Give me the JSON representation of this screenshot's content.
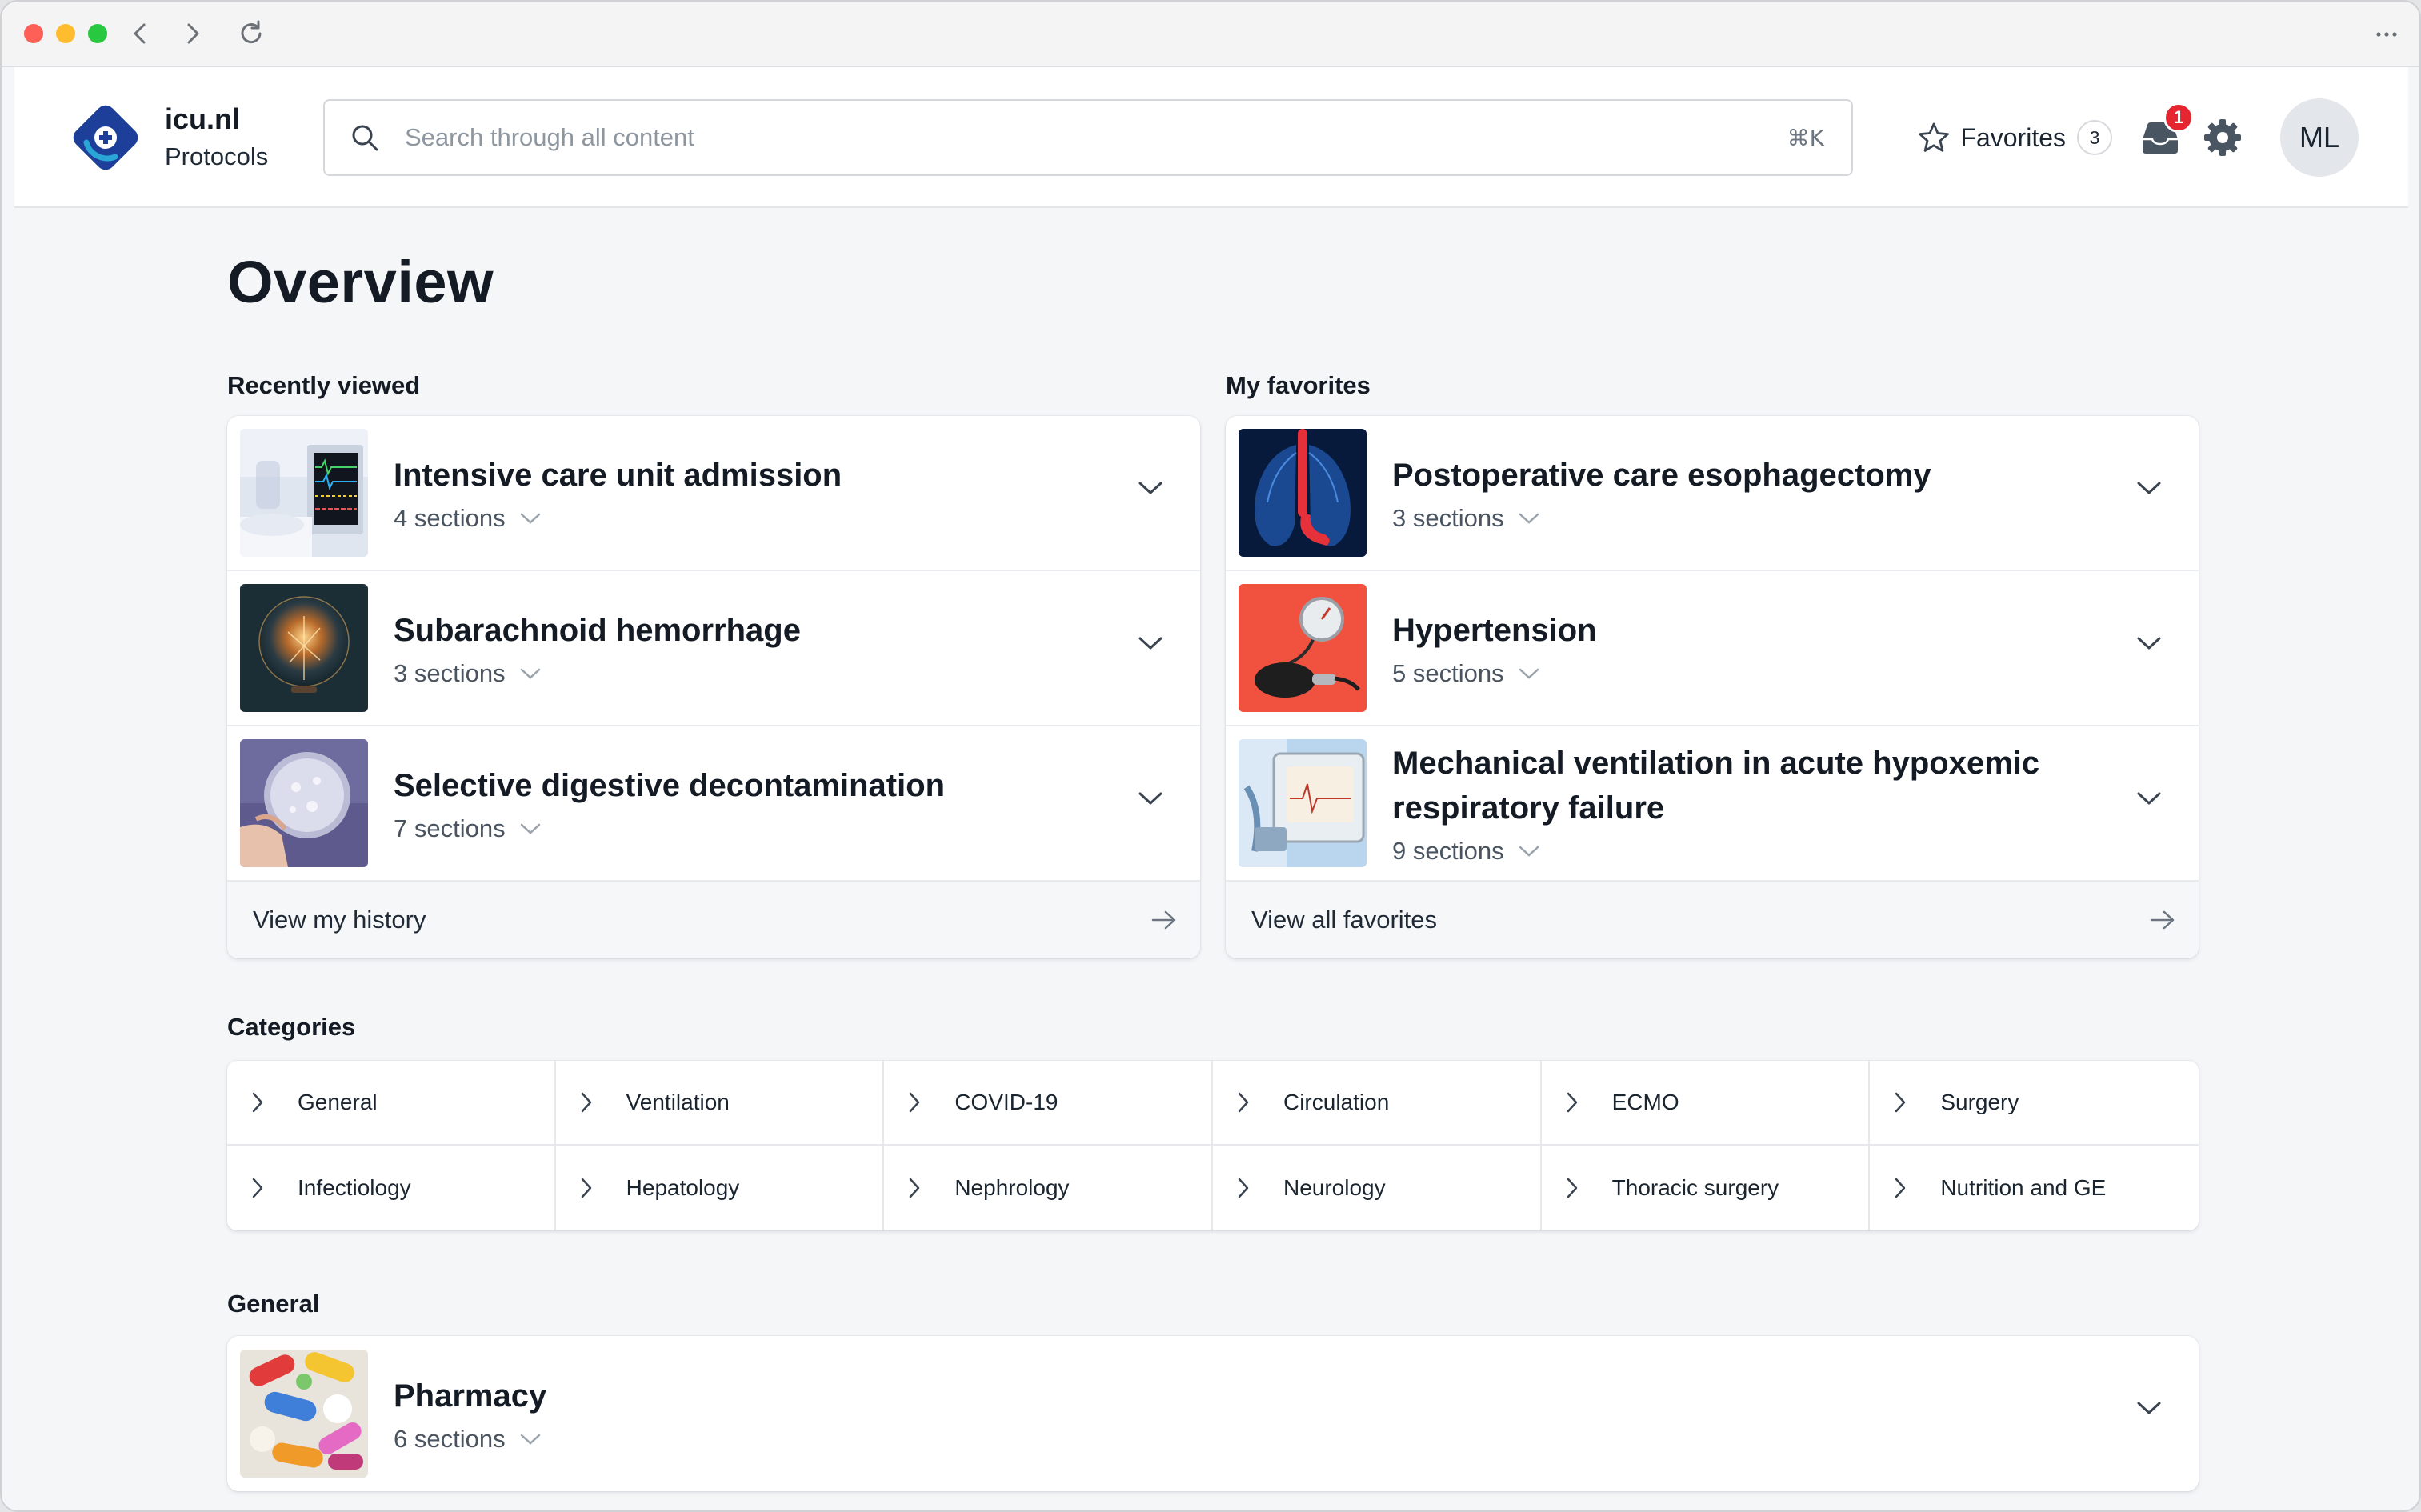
{
  "header": {
    "brand_name": "icu.nl",
    "brand_sub": "Protocols",
    "search_placeholder": "Search through all content",
    "search_shortcut": "⌘K",
    "favorites_label": "Favorites",
    "favorites_count": "3",
    "inbox_badge": "1",
    "avatar_initials": "ML"
  },
  "colors": {
    "brand_primary": "#1d3f9a",
    "brand_accent": "#2aa6d6",
    "badge_red": "#e3262f"
  },
  "main": {
    "title": "Overview",
    "recently_viewed": {
      "label": "Recently viewed",
      "items": [
        {
          "title": "Intensive care unit admission",
          "sections": "4 sections",
          "image": "icu-monitor"
        },
        {
          "title": "Subarachnoid hemorrhage",
          "sections": "3 sections",
          "image": "brain-lights"
        },
        {
          "title": "Selective digestive decontamination",
          "sections": "7 sections",
          "image": "petri-dish"
        }
      ],
      "footer": "View my history"
    },
    "favorites": {
      "label": "My favorites",
      "items": [
        {
          "title": "Postoperative care esophagectomy",
          "sections": "3 sections",
          "image": "lungs-xray"
        },
        {
          "title": "Hypertension",
          "sections": "5 sections",
          "image": "blood-pressure-gauge"
        },
        {
          "title": "Mechanical ventilation in acute hypoxemic respiratory failure",
          "sections": "9 sections",
          "image": "ventilator"
        }
      ],
      "footer": "View all favorites"
    },
    "categories": {
      "label": "Categories",
      "items": [
        "General",
        "Ventilation",
        "COVID-19",
        "Circulation",
        "ECMO",
        "Surgery",
        "Infectiology",
        "Hepatology",
        "Nephrology",
        "Neurology",
        "Thoracic surgery",
        "Nutrition and GE"
      ]
    },
    "general": {
      "label": "General",
      "items": [
        {
          "title": "Pharmacy",
          "sections": "6 sections",
          "image": "pills"
        }
      ]
    }
  }
}
